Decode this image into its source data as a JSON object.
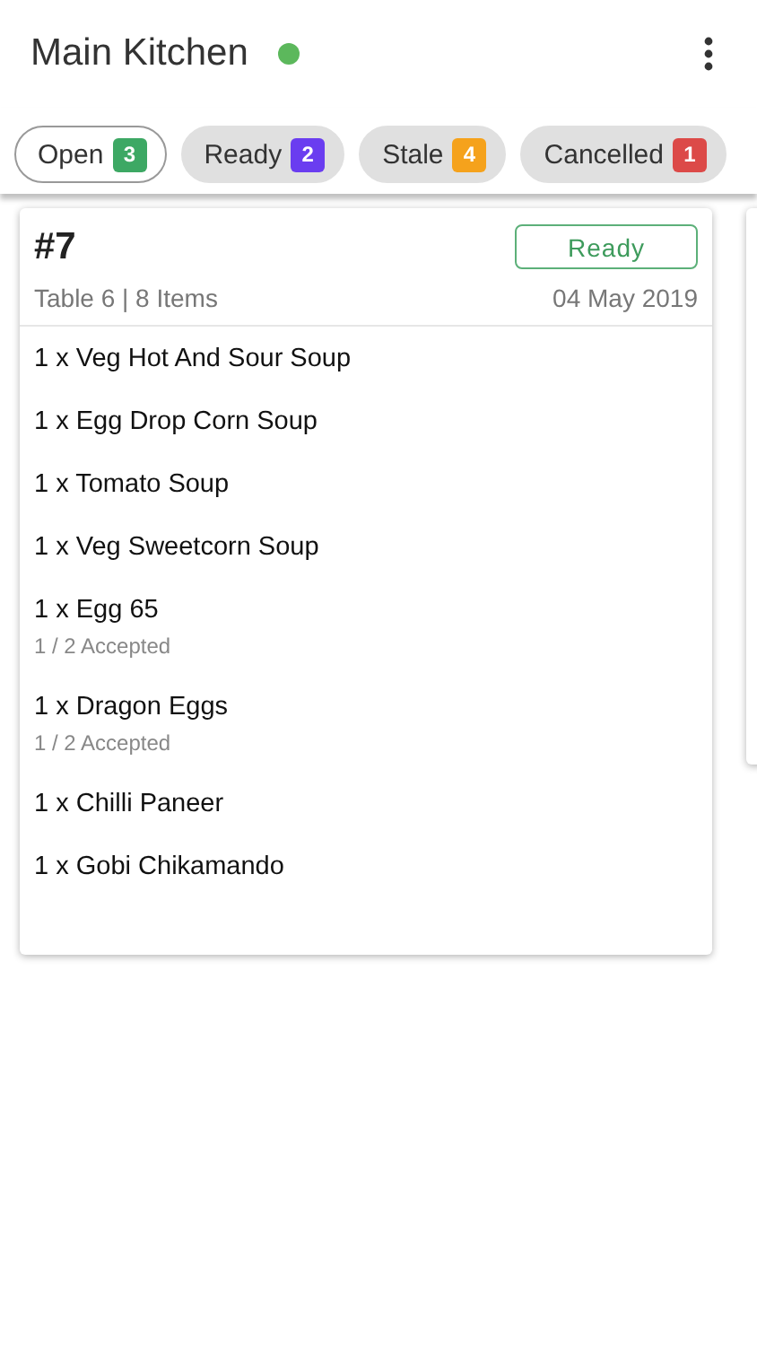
{
  "header": {
    "title": "Main Kitchen",
    "online": true
  },
  "filters": [
    {
      "label": "Open",
      "count": "3",
      "color": "#3da864",
      "selected": true
    },
    {
      "label": "Ready",
      "count": "2",
      "color": "#6a3df0",
      "selected": false
    },
    {
      "label": "Stale",
      "count": "4",
      "color": "#f5a21c",
      "selected": false
    },
    {
      "label": "Cancelled",
      "count": "1",
      "color": "#dc4a48",
      "selected": false
    }
  ],
  "order": {
    "number": "#7",
    "status": "Ready",
    "details": "Table 6 | 8 Items",
    "date": "04 May 2019",
    "items": [
      {
        "name": "1 x Veg Hot And Sour Soup"
      },
      {
        "name": "1 x Egg Drop Corn Soup"
      },
      {
        "name": "1 x Tomato Soup"
      },
      {
        "name": "1 x Veg Sweetcorn Soup"
      },
      {
        "name": "1 x Egg 65",
        "note": "1 / 2 Accepted"
      },
      {
        "name": "1 x Dragon Eggs",
        "note": "1 / 2 Accepted"
      },
      {
        "name": "1 x Chilli Paneer"
      },
      {
        "name": "1 x Gobi Chikamando"
      }
    ]
  }
}
